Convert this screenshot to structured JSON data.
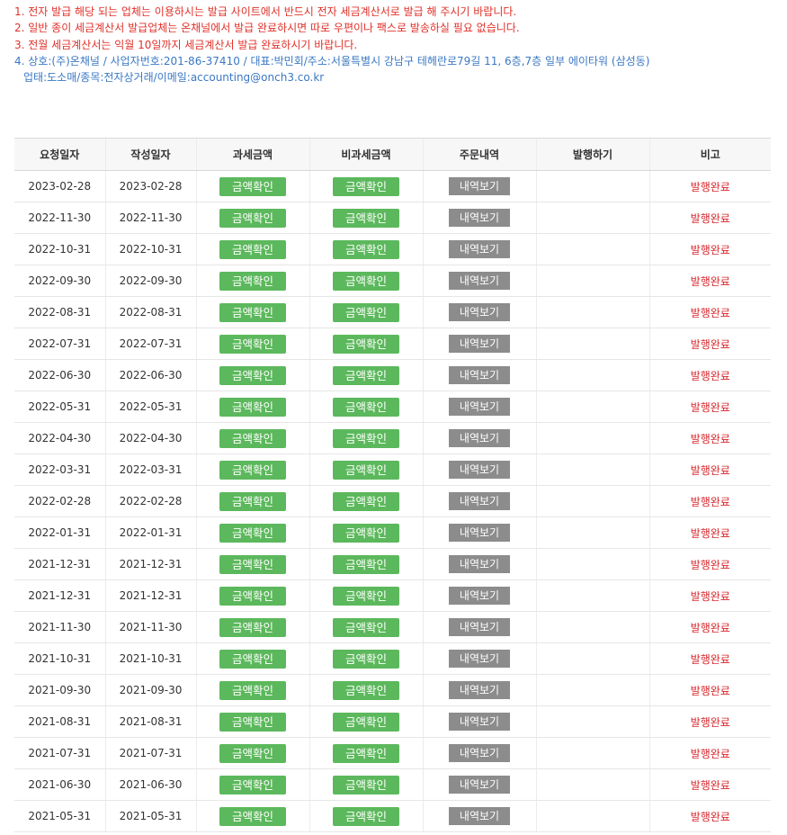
{
  "notices": [
    "1. 전자 발급 해당 되는 업체는 이용하시는 발급 사이트에서 반드시 전자 세금계산서로 발급 해 주시기 바랍니다.",
    "2. 일반 종이 세금계산서 발급업체는 온채널에서 발급 완료하시면 따로 우편이나 팩스로 발송하실 필요 없습니다.",
    "3. 전월 세금계산서는 익월 10일까지 세금계산서 발급 완료하시기 바랍니다.",
    "4. 상호:(주)온채널 / 사업자번호:201-86-37410 / 대표:박민회/주소:서울특별시 강남구 테헤란로79길 11, 6층,7층 일부 에이타워 (삼성동)",
    "업태:도소매/종목:전자상거래/이메일:accounting@onch3.co.kr"
  ],
  "table": {
    "headers": [
      "요청일자",
      "작성일자",
      "과세금액",
      "비과세금액",
      "주문내역",
      "발행하기",
      "비고"
    ],
    "taxable_button": "금액확인",
    "nontaxable_button": "금액확인",
    "order_button": "내역보기",
    "rows": [
      {
        "request_date": "2023-02-28",
        "written_date": "2023-02-28",
        "status": "발행완료"
      },
      {
        "request_date": "2022-11-30",
        "written_date": "2022-11-30",
        "status": "발행완료"
      },
      {
        "request_date": "2022-10-31",
        "written_date": "2022-10-31",
        "status": "발행완료"
      },
      {
        "request_date": "2022-09-30",
        "written_date": "2022-09-30",
        "status": "발행완료"
      },
      {
        "request_date": "2022-08-31",
        "written_date": "2022-08-31",
        "status": "발행완료"
      },
      {
        "request_date": "2022-07-31",
        "written_date": "2022-07-31",
        "status": "발행완료"
      },
      {
        "request_date": "2022-06-30",
        "written_date": "2022-06-30",
        "status": "발행완료"
      },
      {
        "request_date": "2022-05-31",
        "written_date": "2022-05-31",
        "status": "발행완료"
      },
      {
        "request_date": "2022-04-30",
        "written_date": "2022-04-30",
        "status": "발행완료"
      },
      {
        "request_date": "2022-03-31",
        "written_date": "2022-03-31",
        "status": "발행완료"
      },
      {
        "request_date": "2022-02-28",
        "written_date": "2022-02-28",
        "status": "발행완료"
      },
      {
        "request_date": "2022-01-31",
        "written_date": "2022-01-31",
        "status": "발행완료"
      },
      {
        "request_date": "2021-12-31",
        "written_date": "2021-12-31",
        "status": "발행완료"
      },
      {
        "request_date": "2021-12-31",
        "written_date": "2021-12-31",
        "status": "발행완료"
      },
      {
        "request_date": "2021-11-30",
        "written_date": "2021-11-30",
        "status": "발행완료"
      },
      {
        "request_date": "2021-10-31",
        "written_date": "2021-10-31",
        "status": "발행완료"
      },
      {
        "request_date": "2021-09-30",
        "written_date": "2021-09-30",
        "status": "발행완료"
      },
      {
        "request_date": "2021-08-31",
        "written_date": "2021-08-31",
        "status": "발행완료"
      },
      {
        "request_date": "2021-07-31",
        "written_date": "2021-07-31",
        "status": "발행완료"
      },
      {
        "request_date": "2021-06-30",
        "written_date": "2021-06-30",
        "status": "발행완료"
      },
      {
        "request_date": "2021-05-31",
        "written_date": "2021-05-31",
        "status": "발행완료"
      }
    ]
  },
  "colors": {
    "notice_red": "#e0312a",
    "notice_blue": "#3a78c4",
    "button_green": "#5cb85c",
    "button_gray": "#8c8c8c",
    "status_red": "#d8272d"
  }
}
